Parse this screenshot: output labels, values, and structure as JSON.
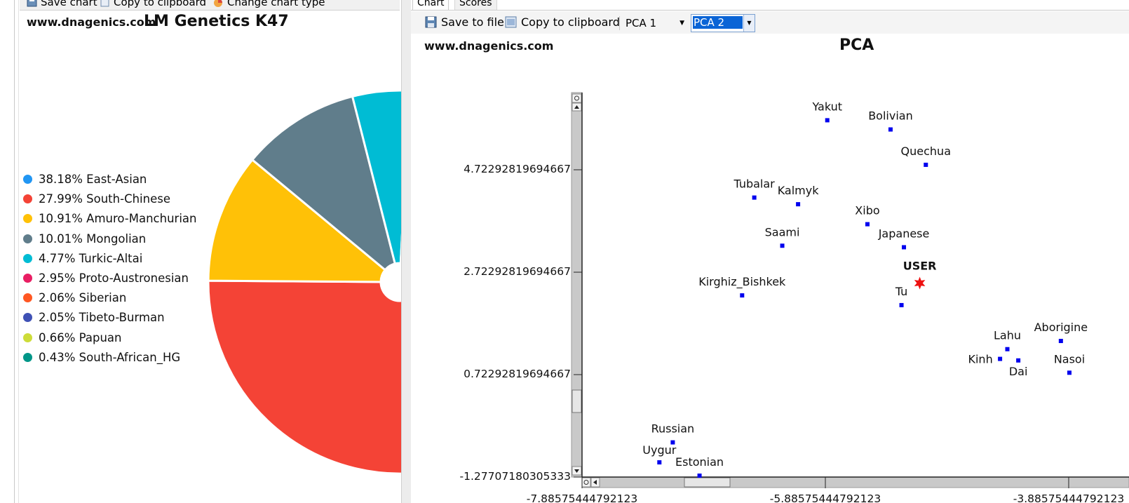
{
  "left_toolbar": {
    "save_chart": "Save chart",
    "copy_clipboard": "Copy to clipboard",
    "change_type": "Change chart type"
  },
  "pie": {
    "watermark": "www.dnagenics.com",
    "title": "LM Genetics K47",
    "chart_data": {
      "type": "pie",
      "title": "LM Genetics K47",
      "slices": [
        {
          "label": "38.18% East-Asian",
          "name": "East-Asian",
          "value": 38.18,
          "color": "#2196f3"
        },
        {
          "label": "27.99% South-Chinese",
          "name": "South-Chinese",
          "value": 27.99,
          "color": "#f44336"
        },
        {
          "label": "10.91% Amuro-Manchurian",
          "name": "Amuro-Manchurian",
          "value": 10.91,
          "color": "#ffc107"
        },
        {
          "label": "10.01% Mongolian",
          "name": "Mongolian",
          "value": 10.01,
          "color": "#607d8b"
        },
        {
          "label": "4.77% Turkic-Altai",
          "name": "Turkic-Altai",
          "value": 4.77,
          "color": "#00bcd4"
        },
        {
          "label": "2.95% Proto-Austronesian",
          "name": "Proto-Austronesian",
          "value": 2.95,
          "color": "#e91e63"
        },
        {
          "label": "2.06% Siberian",
          "name": "Siberian",
          "value": 2.06,
          "color": "#ff5722"
        },
        {
          "label": "2.05% Tibeto-Burman",
          "name": "Tibeto-Burman",
          "value": 2.05,
          "color": "#3f51b5"
        },
        {
          "label": "0.66% Papuan",
          "name": "Papuan",
          "value": 0.66,
          "color": "#cddc39"
        },
        {
          "label": "0.43% South-African_HG",
          "name": "South-African_HG",
          "value": 0.43,
          "color": "#009688"
        }
      ]
    }
  },
  "right_tabs": {
    "chart": "Chart",
    "scores": "Scores"
  },
  "right_toolbar": {
    "save_file": "Save to file",
    "copy_clipboard": "Copy to clipboard",
    "pca_x": "PCA 1",
    "pca_y": "PCA 2"
  },
  "pca": {
    "watermark": "www.dnagenics.com",
    "title": "PCA",
    "chart_data": {
      "type": "scatter",
      "title": "PCA",
      "xlabel": "PCA 1",
      "ylabel": "PCA 2",
      "xlim": [
        -7.88575444792123,
        -3.5
      ],
      "ylim": [
        -1.27707180305333,
        5.95
      ],
      "x_ticks": [
        {
          "value": -7.88575444792123,
          "label": "-7.88575444792123"
        },
        {
          "value": -5.88575444792123,
          "label": "-5.88575444792123"
        },
        {
          "value": -3.88575444792123,
          "label": "-3.88575444792123"
        }
      ],
      "y_ticks": [
        {
          "value": 4.72292819694667,
          "label": "4.72292819694667"
        },
        {
          "value": 2.72292819694667,
          "label": "2.72292819694667"
        },
        {
          "value": 0.72292819694667,
          "label": "0.72292819694667"
        },
        {
          "value": -1.27707180305333,
          "label": "-1.27707180305333"
        }
      ],
      "points": [
        {
          "name": "Yakut",
          "x": -5.87,
          "y": 5.69
        },
        {
          "name": "Bolivian",
          "x": -5.35,
          "y": 5.51
        },
        {
          "name": "Quechua",
          "x": -5.06,
          "y": 4.82
        },
        {
          "name": "Tubalar",
          "x": -6.47,
          "y": 4.18
        },
        {
          "name": "Kalmyk",
          "x": -6.11,
          "y": 4.05
        },
        {
          "name": "Xibo",
          "x": -5.54,
          "y": 3.66
        },
        {
          "name": "Saami",
          "x": -6.24,
          "y": 3.24
        },
        {
          "name": "Japanese",
          "x": -5.24,
          "y": 3.21
        },
        {
          "name": "Tu",
          "x": -5.26,
          "y": 2.08
        },
        {
          "name": "Kirghiz_Bishkek",
          "x": -6.57,
          "y": 2.27
        },
        {
          "name": "Lahu",
          "x": -4.39,
          "y": 1.22
        },
        {
          "name": "Aborigine",
          "x": -3.95,
          "y": 1.38
        },
        {
          "name": "Kinh",
          "x": -4.45,
          "y": 1.03
        },
        {
          "name": "Dai",
          "x": -4.3,
          "y": 1.0
        },
        {
          "name": "Nasoi",
          "x": -3.88,
          "y": 0.76
        },
        {
          "name": "Russian",
          "x": -7.14,
          "y": -0.6
        },
        {
          "name": "Uygur",
          "x": -7.25,
          "y": -0.99
        },
        {
          "name": "Estonian",
          "x": -6.92,
          "y": -1.25
        }
      ],
      "user_point": {
        "name": "USER",
        "x": -5.11,
        "y": 2.51
      }
    }
  },
  "colors": {
    "point": "#0000ee",
    "user": "#ee1111",
    "scrollbar": "#c9c9c9"
  }
}
